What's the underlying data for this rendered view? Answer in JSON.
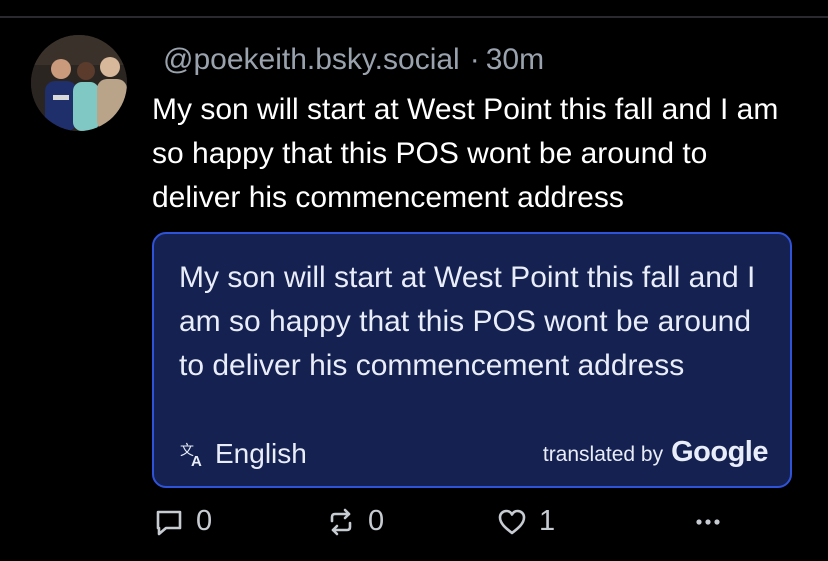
{
  "post": {
    "handle": "@poekeith.bsky.social",
    "separator": "·",
    "time": "30m",
    "text": "My son will start at West Point this fall and I am so happy that this POS wont be around to deliver his commencement address"
  },
  "translation": {
    "text": "My son will start at West Point this fall and I am so happy that this POS wont be around to deliver his commencement address",
    "language": "English",
    "credit_label": "translated by",
    "credit_brand": "Google"
  },
  "actions": {
    "reply_count": "0",
    "repost_count": "0",
    "like_count": "1"
  },
  "icons": {
    "reply": "reply-icon",
    "repost": "repost-icon",
    "like": "heart-icon",
    "more": "more-icon",
    "translate": "translate-icon"
  },
  "colors": {
    "background": "#000000",
    "translation_box": "#142151",
    "translation_border": "#2f53d8",
    "muted_text": "#9aa3ad"
  }
}
